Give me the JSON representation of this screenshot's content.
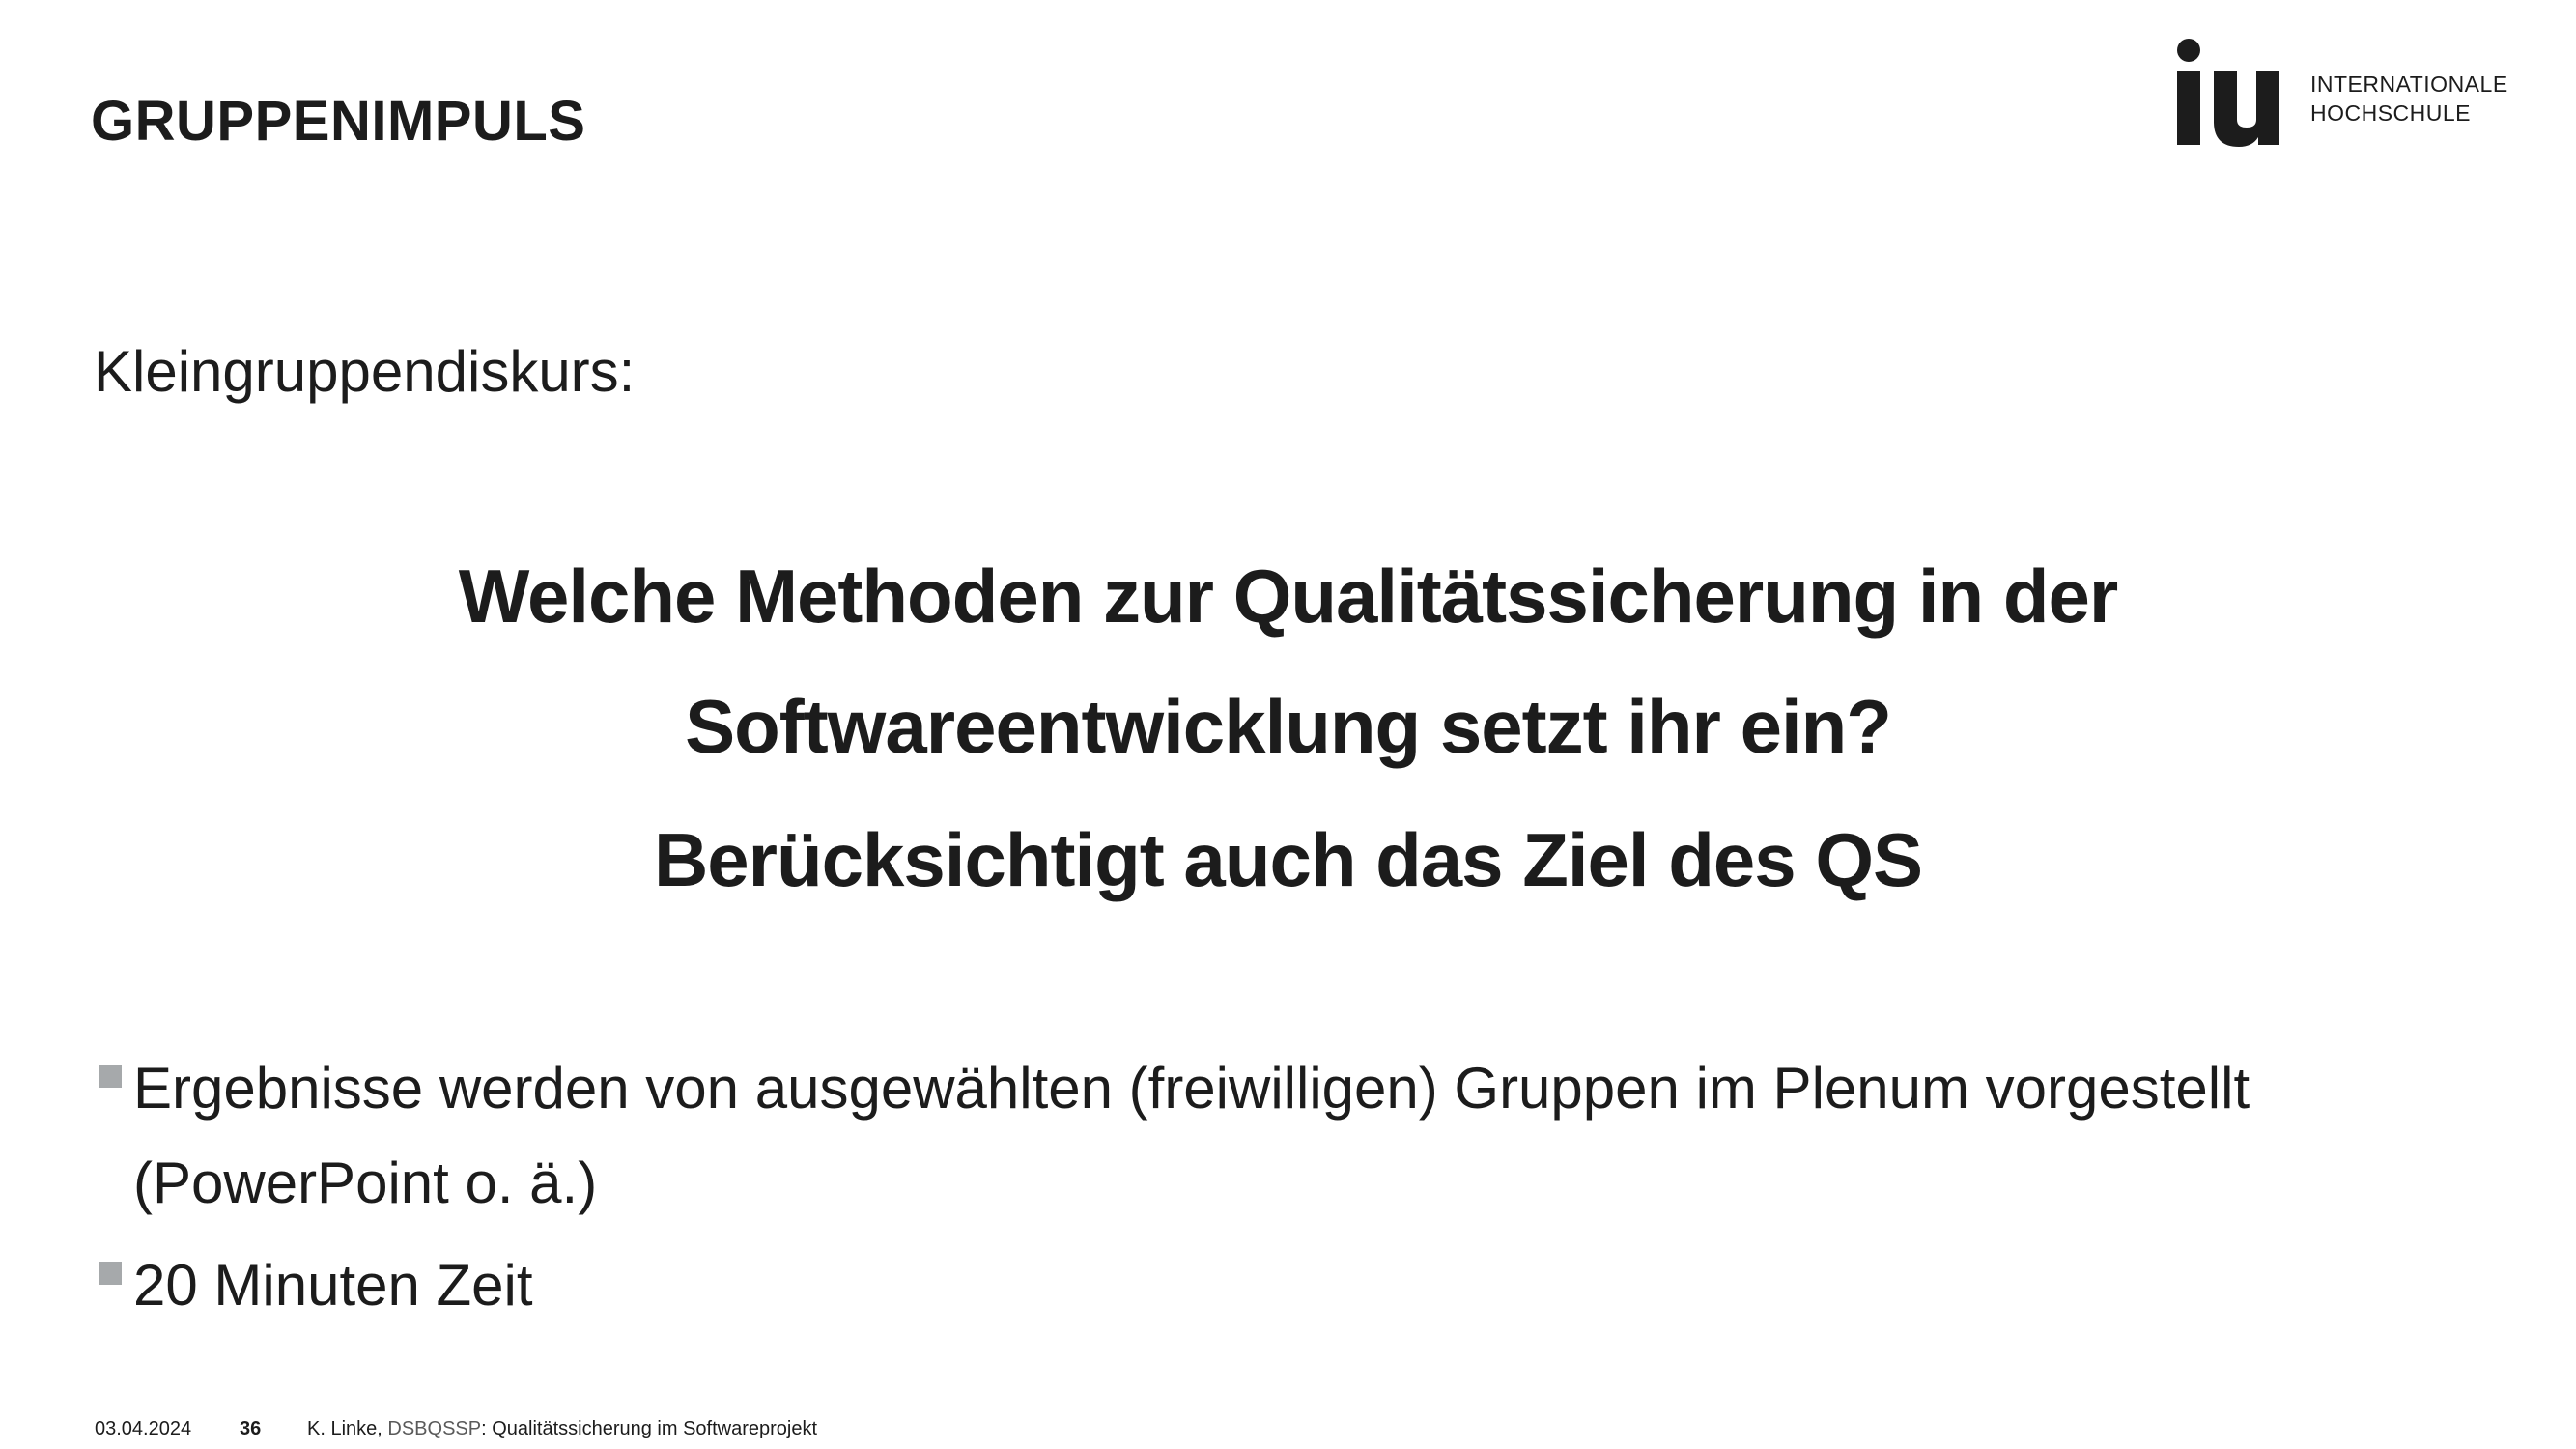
{
  "header": {
    "title": "GRUPPENIMPULS",
    "logo": {
      "mark": "iu",
      "line1": "INTERNATIONALE",
      "line2": "HOCHSCHULE"
    }
  },
  "content": {
    "subtitle": "Kleingruppendiskurs:",
    "question_lines": [
      "Welche Methoden zur Qualitätssicherung in der",
      "Softwareentwicklung setzt ihr ein?",
      "Berücksichtigt auch das Ziel des QS"
    ],
    "bullets": [
      "Ergebnisse werden von ausgewählten (freiwilligen) Gruppen im Plenum vorgestellt (PowerPoint o. ä.)",
      "20 Minuten Zeit"
    ]
  },
  "footer": {
    "date": "03.04.2024",
    "page": "36",
    "author": "K. Linke,",
    "course_code": "DSBQSSP",
    "course_title": ": Qualitätssicherung im Softwareprojekt"
  },
  "colors": {
    "text": "#1c1c1c",
    "bullet_marker": "#a6a9ab",
    "background": "#ffffff"
  },
  "icons": {
    "bullet": "square-bullet-icon",
    "logo": "iu-logo-icon"
  }
}
